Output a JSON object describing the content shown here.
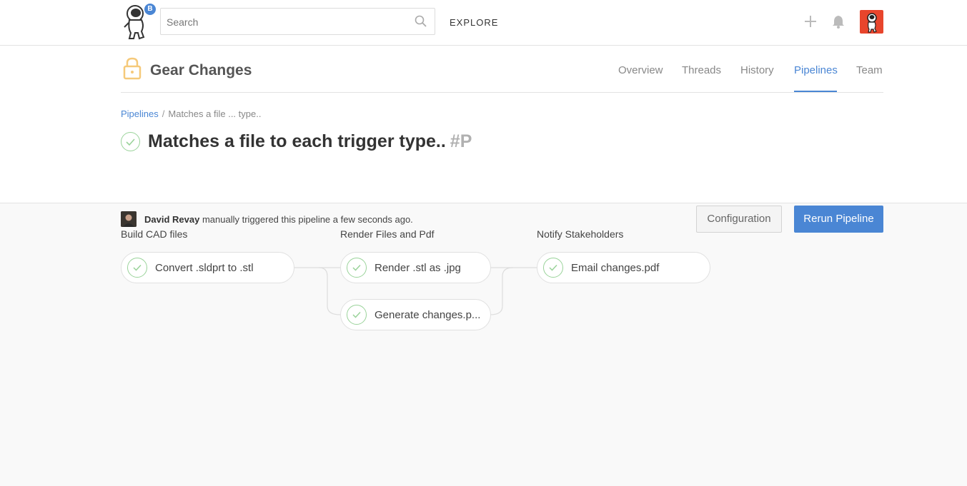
{
  "topbar": {
    "badge": "B",
    "search_placeholder": "Search",
    "explore_label": "EXPLORE",
    "icons": [
      "search-icon",
      "plus-icon",
      "bell-icon"
    ]
  },
  "project": {
    "title": "Gear Changes",
    "tabs": [
      {
        "label": "Overview",
        "active": false
      },
      {
        "label": "Threads",
        "active": false
      },
      {
        "label": "History",
        "active": false
      },
      {
        "label": "Pipelines",
        "active": true
      },
      {
        "label": "Team",
        "active": false
      }
    ]
  },
  "breadcrumb": {
    "root": "Pipelines",
    "separator": "/",
    "current": "Matches a file ... type.."
  },
  "pipeline": {
    "title": "Matches a file to each trigger type..",
    "hash": "#P",
    "user": "David Revay",
    "trigger_text": "manually triggered this pipeline a few seconds ago.",
    "config_button": "Configuration",
    "rerun_button": "Rerun Pipeline"
  },
  "stages": [
    {
      "name": "Build CAD files",
      "jobs": [
        "Convert .sldprt to .stl"
      ]
    },
    {
      "name": "Render Files and Pdf",
      "jobs": [
        "Render .stl as .jpg",
        "Generate changes.p..."
      ]
    },
    {
      "name": "Notify Stakeholders",
      "jobs": [
        "Email changes.pdf"
      ]
    }
  ],
  "colors": {
    "accent": "#4a86d4",
    "success": "#9ad39a",
    "lock": "#f5c97a",
    "avatar_bg": "#e8452c"
  }
}
